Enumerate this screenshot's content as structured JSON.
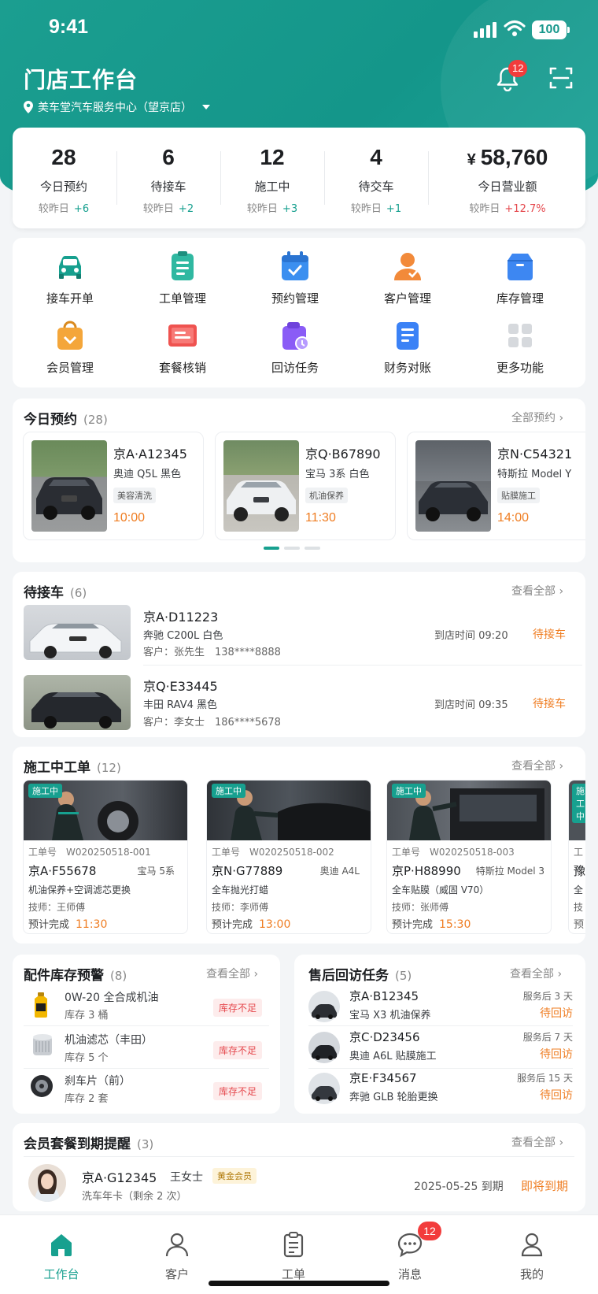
{
  "status": {
    "time": "9:41",
    "battery": "100"
  },
  "header": {
    "title": "门店工作台",
    "store": "美车堂汽车服务中心（望京店）",
    "notif_count": "12"
  },
  "stats": [
    {
      "value": "28",
      "label": "今日预约",
      "cmp_label": "较昨日",
      "cmp": "+6"
    },
    {
      "value": "6",
      "label": "待接车",
      "cmp_label": "较昨日",
      "cmp": "+2"
    },
    {
      "value": "12",
      "label": "施工中",
      "cmp_label": "较昨日",
      "cmp": "+3"
    },
    {
      "value": "4",
      "label": "待交车",
      "cmp_label": "较昨日",
      "cmp": "+1"
    },
    {
      "value": "58,760",
      "currency": "¥",
      "label": "今日营业额",
      "cmp_label": "较昨日",
      "cmp": "+12.7%"
    }
  ],
  "quick": [
    {
      "label": "接车开单",
      "icon": "car-icon",
      "color": "#17a08f"
    },
    {
      "label": "工单管理",
      "icon": "clipboard-icon",
      "color": "#2fb8a1"
    },
    {
      "label": "预约管理",
      "icon": "calendar-icon",
      "color": "#3b8ff0"
    },
    {
      "label": "客户管理",
      "icon": "user-icon",
      "color": "#f28a3a"
    },
    {
      "label": "库存管理",
      "icon": "box-icon",
      "color": "#3d87f2"
    },
    {
      "label": "会员管理",
      "icon": "vip-bag-icon",
      "color": "#f4a63a"
    },
    {
      "label": "套餐核销",
      "icon": "coupon-icon",
      "color": "#ef5350"
    },
    {
      "label": "回访任务",
      "icon": "followup-icon",
      "color": "#8a5cf6"
    },
    {
      "label": "财务对账",
      "icon": "ledger-icon",
      "color": "#3b82f6"
    },
    {
      "label": "更多功能",
      "icon": "grid-icon",
      "color": "#c9cdd2"
    }
  ],
  "appointments": {
    "title": "今日预约",
    "count": "(28)",
    "more": "全部预约",
    "items": [
      {
        "plate": "京A·A12345",
        "model": "奥迪 Q5L 黑色",
        "service": "美容清洗",
        "time": "10:00",
        "car_color": "#2a2d33"
      },
      {
        "plate": "京Q·B67890",
        "model": "宝马 3系 白色",
        "service": "机油保养",
        "time": "11:30",
        "car_color": "#e9ecef"
      },
      {
        "plate": "京N·C54321",
        "model": "特斯拉 Model Y",
        "service": "贴膜施工",
        "time": "14:00",
        "car_color": "#2b2f36"
      }
    ]
  },
  "pending": {
    "title": "待接车",
    "count": "(6)",
    "more": "查看全部",
    "items": [
      {
        "plate": "京A·D11223",
        "model": "奔驰 C200L 白色",
        "customer": "客户：张先生　138****8888",
        "arrival": "到店时间 09:20",
        "status": "待接车",
        "car_color": "#eceff2"
      },
      {
        "plate": "京Q·E33445",
        "model": "丰田 RAV4 黑色",
        "customer": "客户：李女士　186****5678",
        "arrival": "到店时间 09:35",
        "status": "待接车",
        "car_color": "#25282d"
      }
    ]
  },
  "inprogress": {
    "title": "施工中工单",
    "count": "(12)",
    "more": "查看全部",
    "items": [
      {
        "tag": "施工中",
        "no": "工单号　W020250518-001",
        "plate": "京A·F55678",
        "brand": "宝马 5系",
        "service": "机油保养+空调滤芯更换",
        "tech": "技师：王师傅",
        "eta_label": "预计完成",
        "eta": "11:30"
      },
      {
        "tag": "施工中",
        "no": "工单号　W020250518-002",
        "plate": "京N·G77889",
        "brand": "奥迪 A4L",
        "service": "全车抛光打蜡",
        "tech": "技师：李师傅",
        "eta_label": "预计完成",
        "eta": "13:00"
      },
      {
        "tag": "施工中",
        "no": "工单号　W020250518-003",
        "plate": "京P·H88990",
        "brand": "特斯拉 Model 3",
        "service": "全车贴膜（威固 V70）",
        "tech": "技师：张师傅",
        "eta_label": "预计完成",
        "eta": "15:30"
      }
    ],
    "peek": {
      "tag": "施工中",
      "no": "工",
      "plate": "豫",
      "service": "全",
      "tech": "技",
      "eta_label": "预"
    }
  },
  "inventory": {
    "title": "配件库存预警",
    "count": "(8)",
    "more": "查看全部",
    "items": [
      {
        "name": "0W-20 全合成机油",
        "stock": "库存 3 桶",
        "status": "库存不足",
        "icon": "oil-bottle-icon"
      },
      {
        "name": "机油滤芯（丰田）",
        "stock": "库存 5 个",
        "status": "库存不足",
        "icon": "oil-filter-icon"
      },
      {
        "name": "刹车片（前）",
        "stock": "库存 2 套",
        "status": "库存不足",
        "icon": "brake-pad-icon"
      }
    ]
  },
  "followups": {
    "title": "售后回访任务",
    "count": "(5)",
    "more": "查看全部",
    "items": [
      {
        "plate": "京A·B12345",
        "desc": "宝马 X3 机油保养",
        "when": "服务后 3 天",
        "status": "待回访"
      },
      {
        "plate": "京C·D23456",
        "desc": "奥迪 A6L 贴膜施工",
        "when": "服务后 7 天",
        "status": "待回访"
      },
      {
        "plate": "京E·F34567",
        "desc": "奔驰 GLB 轮胎更换",
        "when": "服务后 15 天",
        "status": "待回访"
      }
    ]
  },
  "members": {
    "title": "会员套餐到期提醒",
    "count": "(3)",
    "more": "查看全部",
    "item": {
      "plate": "京A·G12345",
      "name": "王女士",
      "level": "黄金会员",
      "pkg": "洗车年卡（剩余 2 次）",
      "expire": "2025-05-25 到期",
      "status": "即将到期"
    }
  },
  "tabs": [
    {
      "label": "工作台",
      "icon": "home-icon",
      "active": true
    },
    {
      "label": "客户",
      "icon": "person-icon"
    },
    {
      "label": "工单",
      "icon": "clipboard-icon"
    },
    {
      "label": "消息",
      "icon": "chat-icon",
      "badge": "12"
    },
    {
      "label": "我的",
      "icon": "profile-icon"
    }
  ],
  "colors": {
    "primary": "#17a08f",
    "orange": "#ef7d22",
    "red": "#e5484d"
  }
}
